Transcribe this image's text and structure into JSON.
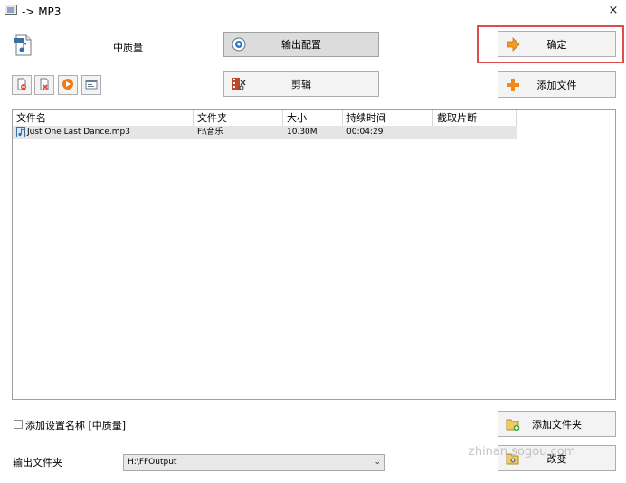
{
  "window": {
    "title": "-> MP3",
    "close_glyph": "×"
  },
  "quality": {
    "label": "中质量"
  },
  "buttons": {
    "output_config": "输出配置",
    "edit": "剪辑",
    "ok": "确定",
    "add_file": "添加文件",
    "add_folder": "添加文件夹",
    "change": "改变"
  },
  "toolbar_icons": [
    "remove-file-icon",
    "clear-list-icon",
    "play-icon",
    "info-icon"
  ],
  "table": {
    "columns": [
      "文件名",
      "文件夹",
      "大小",
      "持续时间",
      "截取片断"
    ],
    "rows": [
      {
        "name": "Just One Last Dance.mp3",
        "folder": "F:\\音乐",
        "size": "10.30M",
        "duration": "00:04:29",
        "clip": ""
      }
    ]
  },
  "checkbox": {
    "label": "添加设置名称 [中质量]",
    "checked": false
  },
  "output": {
    "label": "输出文件夹",
    "value": "H:\\FFOutput"
  },
  "watermark": {
    "text": "zhinan.sogou.com"
  },
  "colors": {
    "highlight_border": "#e04b4b",
    "row_selected": "#e5e5e5",
    "button_bg": "#f3f3f3"
  }
}
